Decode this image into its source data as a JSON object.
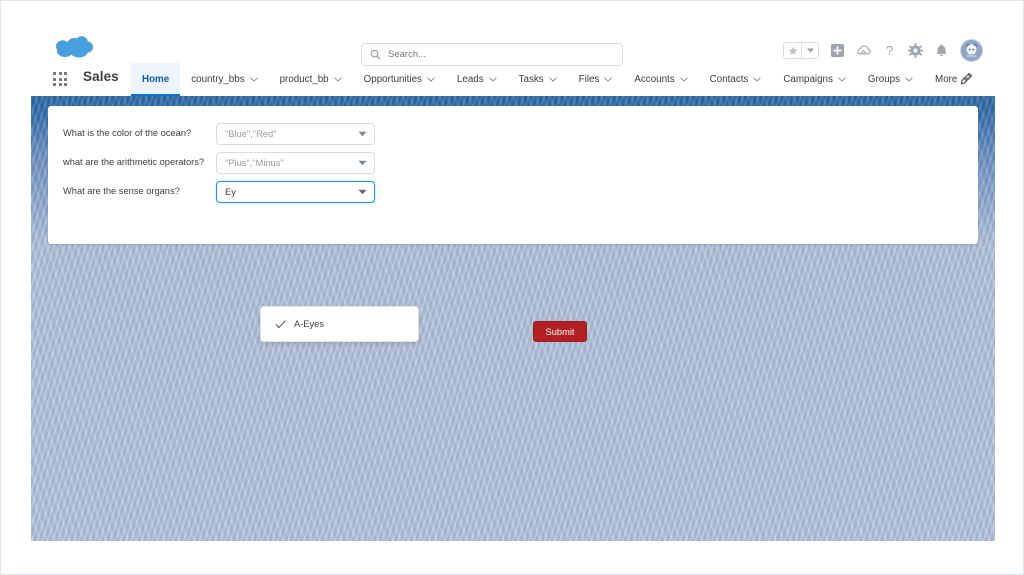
{
  "app": {
    "logo_icon": "salesforce-cloud-icon",
    "app_launcher_icon": "app-launcher-waffle-icon",
    "name": "Sales"
  },
  "search": {
    "placeholder": "Search...",
    "icon": "search-icon",
    "value": ""
  },
  "header_icons": [
    {
      "name": "favorites-star-icon",
      "glyph": "star"
    },
    {
      "name": "favorites-dropdown-icon",
      "glyph": "caret-down"
    },
    {
      "name": "add-item-icon",
      "glyph": "plus-square"
    },
    {
      "name": "setup-cloud-icon",
      "glyph": "cloud"
    },
    {
      "name": "help-icon",
      "glyph": "question-mark"
    },
    {
      "name": "settings-gear-icon",
      "glyph": "gear"
    },
    {
      "name": "notifications-bell-icon",
      "glyph": "bell"
    },
    {
      "name": "user-avatar",
      "glyph": "avatar"
    }
  ],
  "nav": {
    "tabs": [
      {
        "label": "Home",
        "active": true,
        "has_menu": false
      },
      {
        "label": "country_bbs",
        "active": false,
        "has_menu": true
      },
      {
        "label": "product_bb",
        "active": false,
        "has_menu": true
      },
      {
        "label": "Opportunities",
        "active": false,
        "has_menu": true
      },
      {
        "label": "Leads",
        "active": false,
        "has_menu": true
      },
      {
        "label": "Tasks",
        "active": false,
        "has_menu": true
      },
      {
        "label": "Files",
        "active": false,
        "has_menu": true
      },
      {
        "label": "Accounts",
        "active": false,
        "has_menu": true
      },
      {
        "label": "Contacts",
        "active": false,
        "has_menu": true
      },
      {
        "label": "Campaigns",
        "active": false,
        "has_menu": true
      },
      {
        "label": "Groups",
        "active": false,
        "has_menu": true
      },
      {
        "label": "More",
        "active": false,
        "has_menu": true
      }
    ],
    "edit_icon": "pencil-edit-icon"
  },
  "form": {
    "fields": [
      {
        "question": "What is the color of the ocean?",
        "value": "\"Blue\",\"Red\"",
        "focused": false
      },
      {
        "question": "what are the arithmetic operators?",
        "value": "\"Plus\",\"Minus\"",
        "focused": false
      },
      {
        "question": "What are the sense organs?",
        "value": "Ey",
        "focused": true
      }
    ],
    "dropdown": {
      "open": true,
      "options": [
        {
          "label": "A-Eyes",
          "selected": true,
          "icon": "check-icon"
        }
      ]
    },
    "submit_label": "Submit"
  },
  "colors": {
    "brand_blue": "#0176d3",
    "submit_red": "#b32024",
    "focus_blue": "#1b96ff",
    "banner_blue": "#2f6aab",
    "page_bg": "#b6c6e0"
  }
}
